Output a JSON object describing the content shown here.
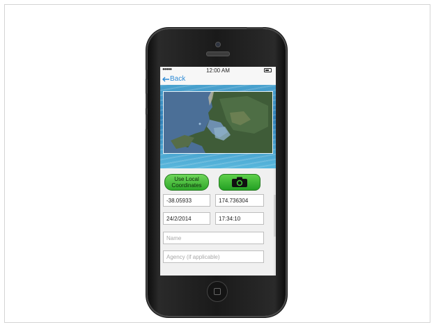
{
  "statusbar": {
    "signal": "●●●●●",
    "time": "12:00 AM"
  },
  "navbar": {
    "back_label": "Back"
  },
  "actions": {
    "use_local_label": "Use Local Coordinates"
  },
  "fields": {
    "latitude": "-38.05933",
    "longitude": "174.736304",
    "date": "24/2/2014",
    "time": "17:34:10",
    "name_placeholder": "Name",
    "agency_placeholder": "Agency (if applicable)"
  },
  "icons": {
    "back": "arrow-left-icon",
    "camera": "camera-icon",
    "battery": "battery-icon"
  },
  "colors": {
    "accent_green": "#2fa82a",
    "link_blue": "#2e8bd6"
  }
}
